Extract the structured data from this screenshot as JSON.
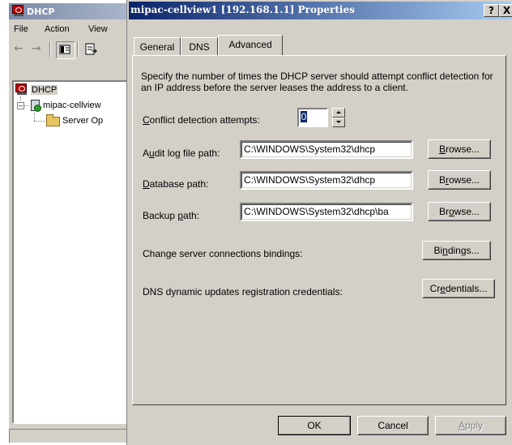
{
  "background_window": {
    "title": "DHCP",
    "menu": [
      "File",
      "Action",
      "View"
    ],
    "tree": {
      "root": "DHCP",
      "server": "mipac-cellview",
      "child": "Server Op"
    },
    "icons": [
      "back-arrow-icon",
      "forward-arrow-icon",
      "show-hide-tree-icon",
      "export-list-icon"
    ]
  },
  "dialog": {
    "title": "mipac-cellview1 [192.168.1.1] Properties",
    "caption_buttons": {
      "help": "?",
      "close": "X"
    },
    "tabs": [
      {
        "label": "General",
        "active": false
      },
      {
        "label": "DNS",
        "active": false
      },
      {
        "label": "Advanced",
        "active": true
      }
    ],
    "advanced": {
      "description": "Specify the number of times the DHCP server should attempt conflict detection for an IP address before the server leases the address to a client.",
      "conflict_label": "Conflict detection attempts:",
      "conflict_value": "0",
      "audit_label": "Audit log file path:",
      "audit_value": "C:\\WINDOWS\\System32\\dhcp",
      "database_label": "Database path:",
      "database_value": "C:\\WINDOWS\\System32\\dhcp",
      "backup_label": "Backup path:",
      "backup_value": "C:\\WINDOWS\\System32\\dhcp\\ba",
      "browse_label": "Browse...",
      "bindings_text": "Change server connections bindings:",
      "bindings_button": "Bindings...",
      "credentials_text": "DNS dynamic updates registration credentials:",
      "credentials_button": "Credentials..."
    },
    "footer": {
      "ok": "OK",
      "cancel": "Cancel",
      "apply": "Apply"
    }
  }
}
